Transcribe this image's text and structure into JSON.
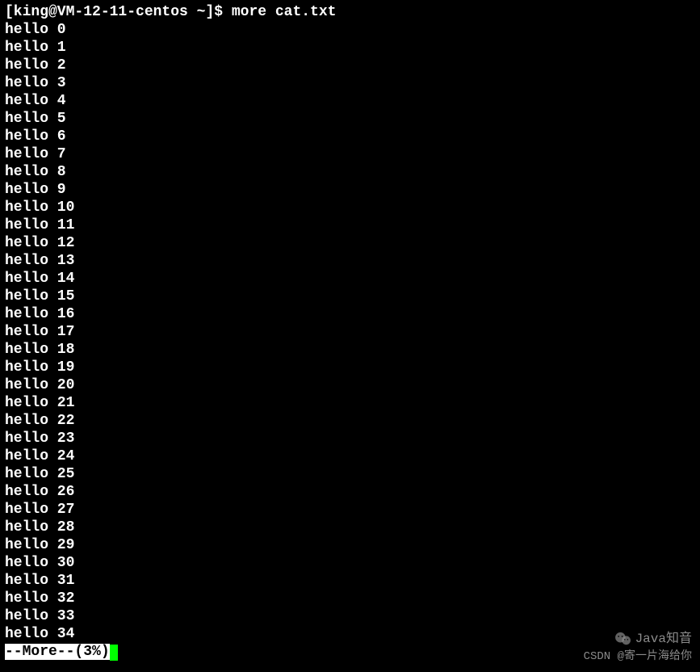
{
  "prompt": "[king@VM-12-11-centos ~]$ more cat.txt",
  "lines": [
    "hello 0",
    "hello 1",
    "hello 2",
    "hello 3",
    "hello 4",
    "hello 5",
    "hello 6",
    "hello 7",
    "hello 8",
    "hello 9",
    "hello 10",
    "hello 11",
    "hello 12",
    "hello 13",
    "hello 14",
    "hello 15",
    "hello 16",
    "hello 17",
    "hello 18",
    "hello 19",
    "hello 20",
    "hello 21",
    "hello 22",
    "hello 23",
    "hello 24",
    "hello 25",
    "hello 26",
    "hello 27",
    "hello 28",
    "hello 29",
    "hello 30",
    "hello 31",
    "hello 32",
    "hello 33",
    "hello 34"
  ],
  "more_status": "--More--(3%)",
  "watermark1": "Java知音",
  "watermark2": "CSDN @寄一片海给你"
}
